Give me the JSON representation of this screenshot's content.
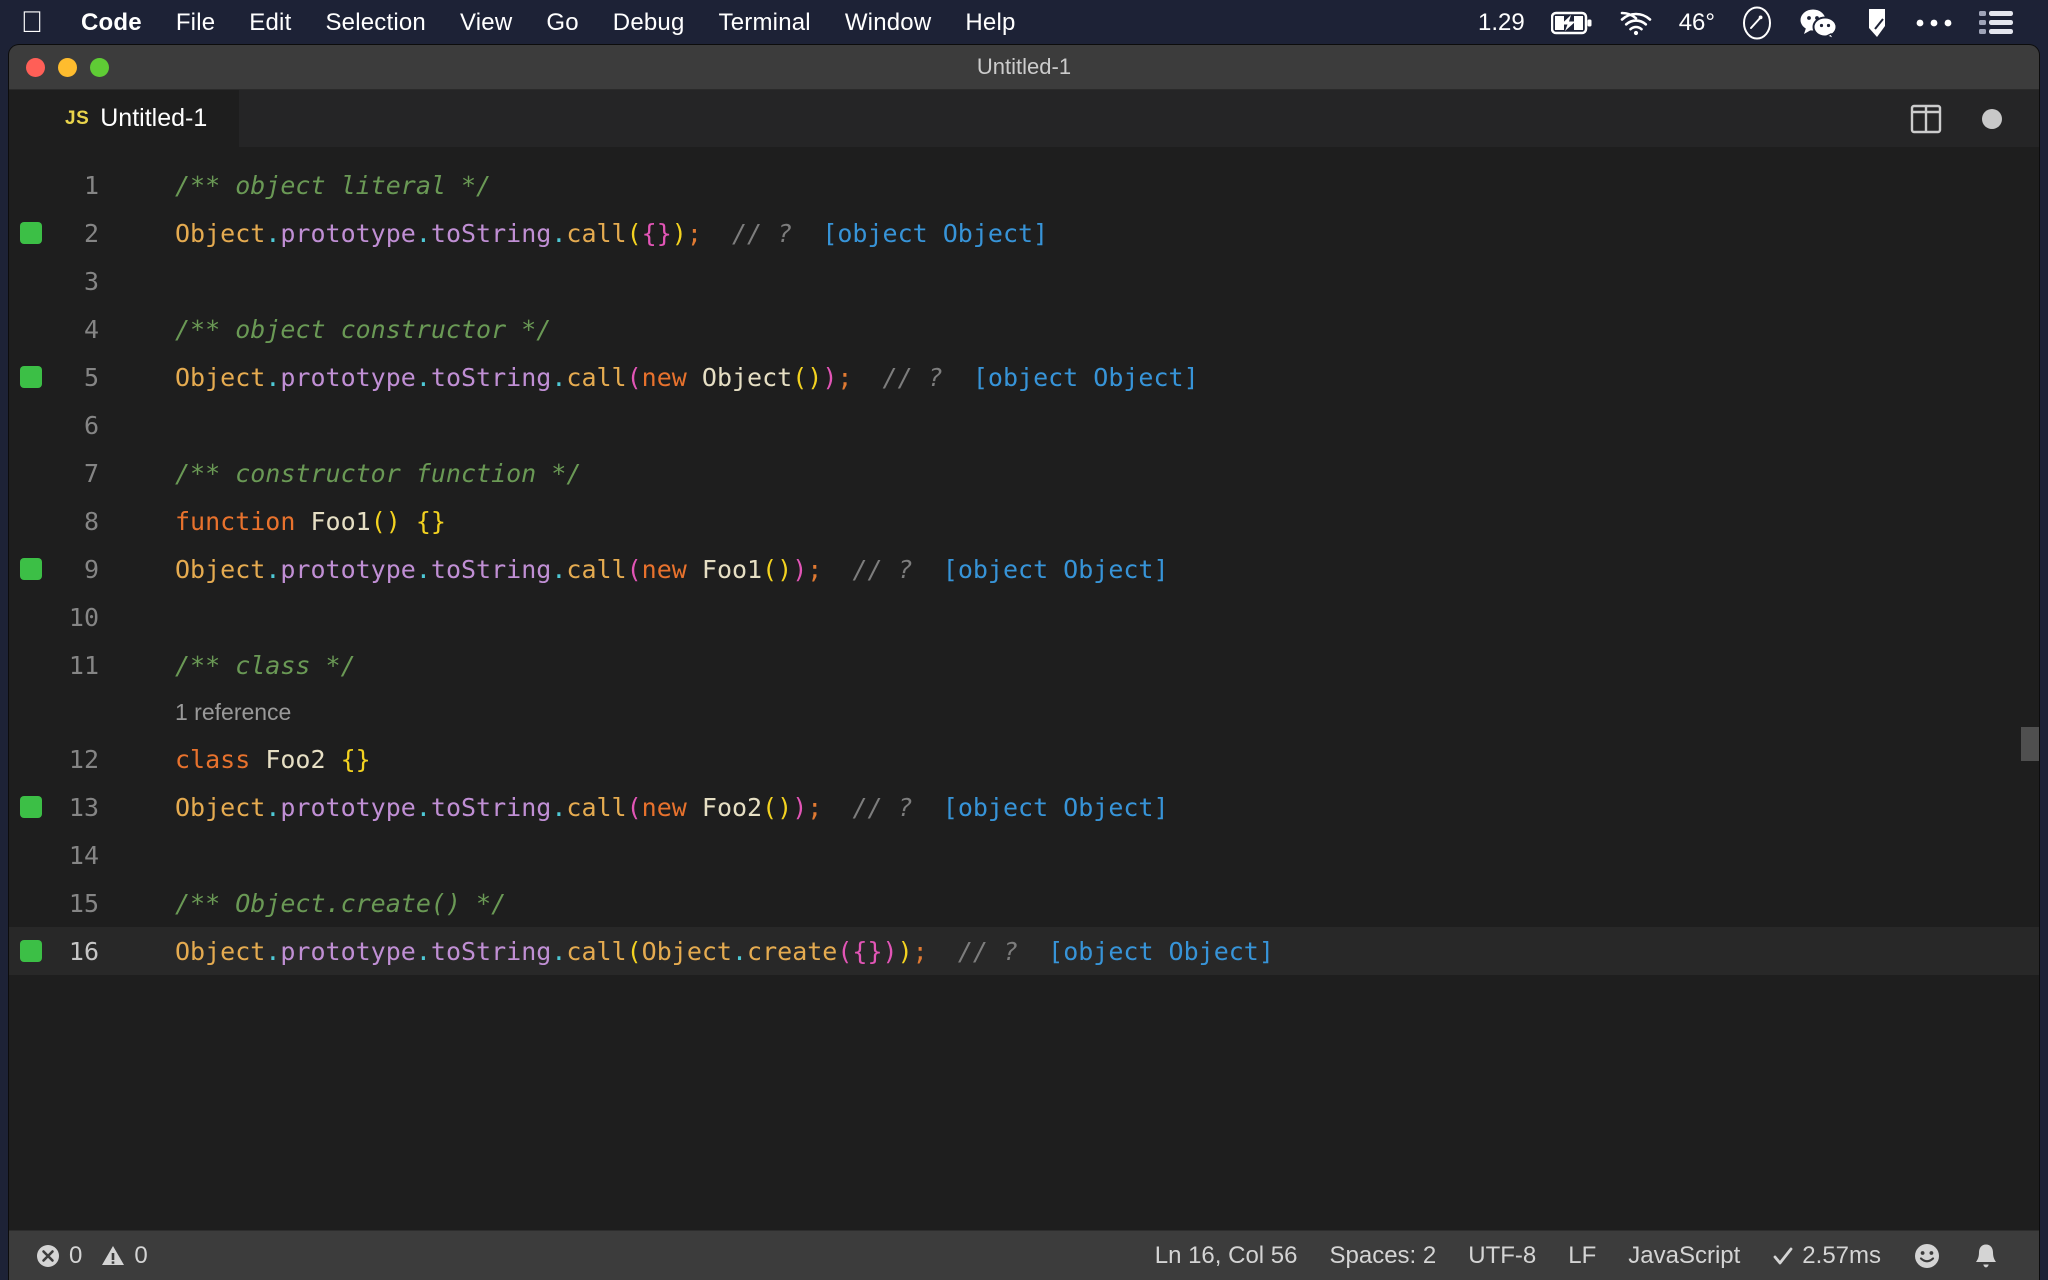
{
  "menubar": {
    "apple_icon": "apple-logo-icon",
    "items": [
      {
        "label": "Code",
        "bold": true
      },
      {
        "label": "File",
        "bold": false
      },
      {
        "label": "Edit",
        "bold": false
      },
      {
        "label": "Selection",
        "bold": false
      },
      {
        "label": "View",
        "bold": false
      },
      {
        "label": "Go",
        "bold": false
      },
      {
        "label": "Debug",
        "bold": false
      },
      {
        "label": "Terminal",
        "bold": false
      },
      {
        "label": "Window",
        "bold": false
      },
      {
        "label": "Help",
        "bold": false
      }
    ],
    "tray": {
      "clock": "1.29",
      "battery_icon": "battery-charging-icon",
      "wifi_icon": "wifi-icon",
      "temperature": "46°",
      "siri_icon": "siri-icon",
      "wechat_icon": "wechat-icon",
      "app_icon": "unknown-app-icon",
      "overflow_icon": "ellipsis-icon",
      "control_center_icon": "control-center-icon"
    }
  },
  "window": {
    "title": "Untitled-1",
    "traffic_lights": [
      "close",
      "minimize",
      "zoom"
    ]
  },
  "tabbar": {
    "tab": {
      "file_icon_label": "JS",
      "label": "Untitled-1"
    },
    "actions": {
      "split_editor_icon": "split-editor-icon",
      "modified_dot": "unsaved-changes-dot"
    }
  },
  "editor": {
    "language": "javascript",
    "codelens": "1 reference",
    "codelens_after_line": 11,
    "active_line": 16,
    "breakpoint_lines": [
      2,
      5,
      9,
      13,
      16
    ],
    "lines": [
      {
        "n": 1,
        "tokens": [
          {
            "t": "/** object literal */",
            "c": "t-comment"
          }
        ]
      },
      {
        "n": 2,
        "tokens": [
          {
            "t": "Object",
            "c": "t-obj"
          },
          {
            "t": ".",
            "c": "t-dot"
          },
          {
            "t": "prototype",
            "c": "t-prop"
          },
          {
            "t": ".",
            "c": "t-dot"
          },
          {
            "t": "toString",
            "c": "t-prop"
          },
          {
            "t": ".",
            "c": "t-dot"
          },
          {
            "t": "call",
            "c": "t-obj"
          },
          {
            "t": "(",
            "c": "t-punct-y"
          },
          {
            "t": "{}",
            "c": "t-punct-m"
          },
          {
            "t": ")",
            "c": "t-punct-y"
          },
          {
            "t": ";",
            "c": "t-semi"
          },
          {
            "t": "  // ?  ",
            "c": "t-linec"
          },
          {
            "t": "[object Object]",
            "c": "t-str"
          }
        ]
      },
      {
        "n": 3,
        "tokens": []
      },
      {
        "n": 4,
        "tokens": [
          {
            "t": "/** object constructor */",
            "c": "t-comment"
          }
        ]
      },
      {
        "n": 5,
        "tokens": [
          {
            "t": "Object",
            "c": "t-obj"
          },
          {
            "t": ".",
            "c": "t-dot"
          },
          {
            "t": "prototype",
            "c": "t-prop"
          },
          {
            "t": ".",
            "c": "t-dot"
          },
          {
            "t": "toString",
            "c": "t-prop"
          },
          {
            "t": ".",
            "c": "t-dot"
          },
          {
            "t": "call",
            "c": "t-obj"
          },
          {
            "t": "(",
            "c": "t-punct-m"
          },
          {
            "t": "new ",
            "c": "t-keyword"
          },
          {
            "t": "Object",
            "c": "t-ident"
          },
          {
            "t": "()",
            "c": "t-punct-y"
          },
          {
            "t": ")",
            "c": "t-punct-m"
          },
          {
            "t": ";",
            "c": "t-semi"
          },
          {
            "t": "  // ?  ",
            "c": "t-linec"
          },
          {
            "t": "[object Object]",
            "c": "t-str"
          }
        ]
      },
      {
        "n": 6,
        "tokens": []
      },
      {
        "n": 7,
        "tokens": [
          {
            "t": "/** constructor function */",
            "c": "t-comment"
          }
        ]
      },
      {
        "n": 8,
        "tokens": [
          {
            "t": "function ",
            "c": "t-keyword"
          },
          {
            "t": "Foo1",
            "c": "t-ident"
          },
          {
            "t": "()",
            "c": "t-punct-y"
          },
          {
            "t": " ",
            "c": "t-ident"
          },
          {
            "t": "{}",
            "c": "t-punct-y"
          }
        ]
      },
      {
        "n": 9,
        "tokens": [
          {
            "t": "Object",
            "c": "t-obj"
          },
          {
            "t": ".",
            "c": "t-dot"
          },
          {
            "t": "prototype",
            "c": "t-prop"
          },
          {
            "t": ".",
            "c": "t-dot"
          },
          {
            "t": "toString",
            "c": "t-prop"
          },
          {
            "t": ".",
            "c": "t-dot"
          },
          {
            "t": "call",
            "c": "t-obj"
          },
          {
            "t": "(",
            "c": "t-punct-m"
          },
          {
            "t": "new ",
            "c": "t-keyword"
          },
          {
            "t": "Foo1",
            "c": "t-ident"
          },
          {
            "t": "()",
            "c": "t-punct-y"
          },
          {
            "t": ")",
            "c": "t-punct-m"
          },
          {
            "t": ";",
            "c": "t-semi"
          },
          {
            "t": "  // ?  ",
            "c": "t-linec"
          },
          {
            "t": "[object Object]",
            "c": "t-str"
          }
        ]
      },
      {
        "n": 10,
        "tokens": []
      },
      {
        "n": 11,
        "tokens": [
          {
            "t": "/** class */",
            "c": "t-comment"
          }
        ]
      },
      {
        "n": 12,
        "tokens": [
          {
            "t": "class ",
            "c": "t-keyword"
          },
          {
            "t": "Foo2",
            "c": "t-ident"
          },
          {
            "t": " ",
            "c": "t-ident"
          },
          {
            "t": "{}",
            "c": "t-punct-y"
          }
        ]
      },
      {
        "n": 13,
        "tokens": [
          {
            "t": "Object",
            "c": "t-obj"
          },
          {
            "t": ".",
            "c": "t-dot"
          },
          {
            "t": "prototype",
            "c": "t-prop"
          },
          {
            "t": ".",
            "c": "t-dot"
          },
          {
            "t": "toString",
            "c": "t-prop"
          },
          {
            "t": ".",
            "c": "t-dot"
          },
          {
            "t": "call",
            "c": "t-obj"
          },
          {
            "t": "(",
            "c": "t-punct-m"
          },
          {
            "t": "new ",
            "c": "t-keyword"
          },
          {
            "t": "Foo2",
            "c": "t-ident"
          },
          {
            "t": "()",
            "c": "t-punct-y"
          },
          {
            "t": ")",
            "c": "t-punct-m"
          },
          {
            "t": ";",
            "c": "t-semi"
          },
          {
            "t": "  // ?  ",
            "c": "t-linec"
          },
          {
            "t": "[object Object]",
            "c": "t-str"
          }
        ]
      },
      {
        "n": 14,
        "tokens": []
      },
      {
        "n": 15,
        "tokens": [
          {
            "t": "/** Object.create() */",
            "c": "t-comment"
          }
        ]
      },
      {
        "n": 16,
        "tokens": [
          {
            "t": "Object",
            "c": "t-obj"
          },
          {
            "t": ".",
            "c": "t-dot"
          },
          {
            "t": "prototype",
            "c": "t-prop"
          },
          {
            "t": ".",
            "c": "t-dot"
          },
          {
            "t": "toString",
            "c": "t-prop"
          },
          {
            "t": ".",
            "c": "t-dot"
          },
          {
            "t": "call",
            "c": "t-obj"
          },
          {
            "t": "(",
            "c": "t-punct-y"
          },
          {
            "t": "Object",
            "c": "t-obj"
          },
          {
            "t": ".",
            "c": "t-dot"
          },
          {
            "t": "create",
            "c": "t-obj"
          },
          {
            "t": "(",
            "c": "t-punct-m"
          },
          {
            "t": "{}",
            "c": "t-punct-m"
          },
          {
            "t": ")",
            "c": "t-punct-m"
          },
          {
            "t": ")",
            "c": "t-punct-y"
          },
          {
            "t": ";",
            "c": "t-semi"
          },
          {
            "t": "  // ?  ",
            "c": "t-linec"
          },
          {
            "t": "[object Object]",
            "c": "t-str"
          }
        ]
      }
    ]
  },
  "statusbar": {
    "errors_icon": "error-circle-icon",
    "errors": "0",
    "warnings_icon": "warning-triangle-icon",
    "warnings": "0",
    "cursor_position": "Ln 16, Col 56",
    "indentation": "Spaces: 2",
    "encoding": "UTF-8",
    "eol": "LF",
    "language_mode": "JavaScript",
    "check_icon": "checkmark-icon",
    "run_time": "2.57ms",
    "feedback_icon": "smiley-icon",
    "notifications_icon": "bell-icon"
  },
  "colors": {
    "menubar_bg": "#1d2236",
    "titlebar_bg": "#3c3c3c",
    "editor_bg": "#1e1e1e",
    "tabbar_bg": "#252526",
    "statusbar_bg": "#3c3c3c",
    "breakpoint": "#3cbf46",
    "comment": "#6a9955",
    "string_blue": "#3794d8",
    "keyword_orange": "#e8722d"
  }
}
